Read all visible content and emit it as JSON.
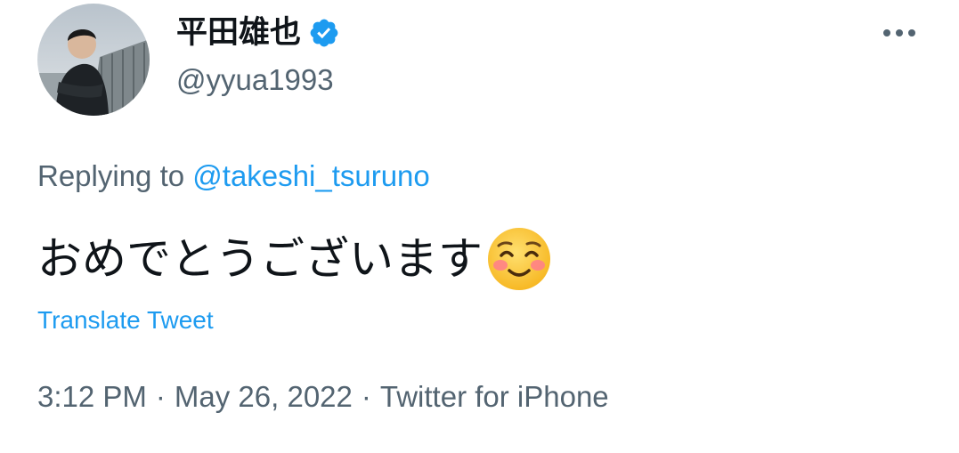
{
  "author": {
    "display_name": "平田雄也",
    "handle": "@yyua1993",
    "verified": true,
    "avatar_icon": "profile-photo"
  },
  "header": {
    "more_icon": "more-horizontal-icon"
  },
  "reply": {
    "prefix": "Replying to",
    "mention": "@takeshi_tsuruno"
  },
  "tweet": {
    "text": "おめでとうございます",
    "emoji_icon": "smiling-face-with-blush-emoji"
  },
  "actions": {
    "translate_label": "Translate Tweet"
  },
  "meta": {
    "time": "3:12 PM",
    "separator": "·",
    "date": "May 26, 2022",
    "source": "Twitter for iPhone"
  },
  "colors": {
    "accent": "#1d9bf0",
    "text": "#0f1419",
    "secondary": "#536471"
  }
}
